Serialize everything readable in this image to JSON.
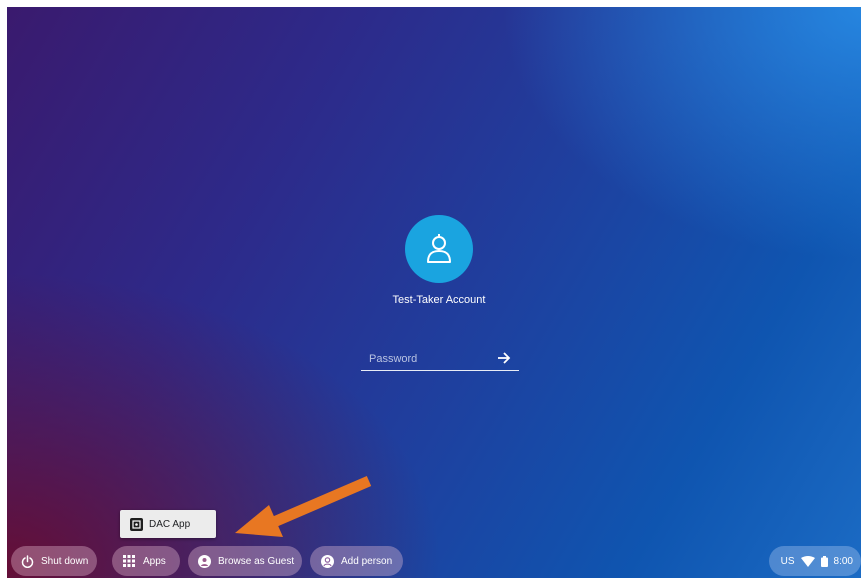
{
  "account": {
    "name": "Test-Taker Account",
    "password_placeholder": "Password",
    "password_value": ""
  },
  "shelf": {
    "shutdown_label": "Shut down",
    "apps_label": "Apps",
    "guest_label": "Browse as Guest",
    "add_person_label": "Add person"
  },
  "apps_menu": {
    "items": [
      {
        "label": "DAC App",
        "icon": "dac-app-icon"
      }
    ]
  },
  "status": {
    "keyboard_layout": "US",
    "time": "8:00",
    "icons": [
      "wifi-icon",
      "battery-icon"
    ]
  },
  "colors": {
    "avatar_bg": "#1aa4e0",
    "annotation_arrow": "#e87722",
    "popup_bg": "#ececec"
  }
}
